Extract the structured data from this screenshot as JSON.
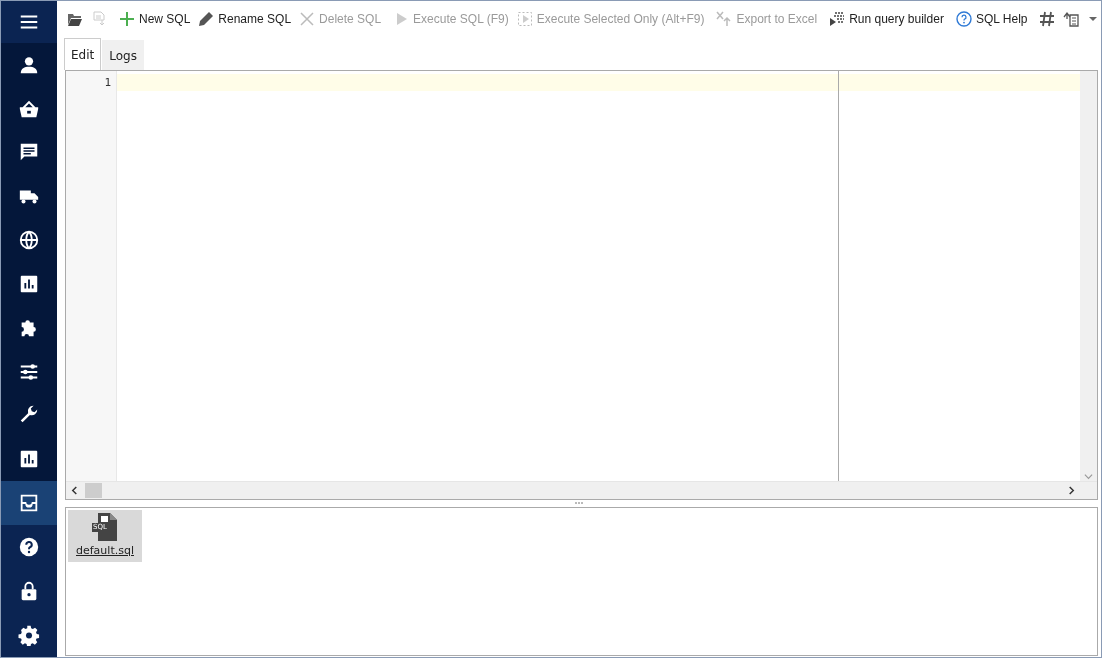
{
  "sidebar": {
    "menu_button": {
      "selected": false
    },
    "nav_items": [
      {
        "selected": false
      },
      {
        "selected": false
      },
      {
        "selected": false
      },
      {
        "selected": false
      },
      {
        "selected": false
      },
      {
        "selected": false
      },
      {
        "selected": false
      },
      {
        "selected": false
      },
      {
        "selected": false
      },
      {
        "selected": false
      },
      {
        "selected": true
      }
    ],
    "utility_items": [
      {
        "selected": false
      },
      {
        "selected": false
      },
      {
        "selected": false
      }
    ]
  },
  "toolbar": [
    {
      "kind": "icon",
      "disabled": false
    },
    {
      "kind": "icon",
      "disabled": true
    },
    {
      "kind": "separator"
    },
    {
      "kind": "button",
      "label": "New SQL",
      "disabled": false
    },
    {
      "kind": "button",
      "label": "Rename SQL",
      "disabled": false
    },
    {
      "kind": "button",
      "label": "Delete SQL",
      "disabled": true
    },
    {
      "kind": "separator"
    },
    {
      "kind": "button",
      "label": "Execute SQL (F9)",
      "disabled": true
    },
    {
      "kind": "button",
      "label": "Execute Selected Only (Alt+F9)",
      "disabled": true
    },
    {
      "kind": "separator"
    },
    {
      "kind": "button",
      "label": "Export to Excel",
      "disabled": true
    },
    {
      "kind": "separator"
    },
    {
      "kind": "button",
      "label": "Run query builder",
      "disabled": false
    },
    {
      "kind": "separator"
    },
    {
      "kind": "button",
      "label": "SQL Help",
      "disabled": false
    },
    {
      "kind": "separator"
    },
    {
      "kind": "icon",
      "disabled": false
    },
    {
      "kind": "icon",
      "disabled": false
    },
    {
      "kind": "dropdown",
      "disabled": false
    }
  ],
  "tabs": [
    {
      "label": "Edit",
      "selected": true
    },
    {
      "label": "Logs",
      "selected": false
    }
  ],
  "editor": {
    "lines": [
      {
        "number": "1",
        "current": true
      }
    ]
  },
  "files": [
    {
      "name": "default.sql",
      "badge": "SQL",
      "selected": true
    }
  ]
}
